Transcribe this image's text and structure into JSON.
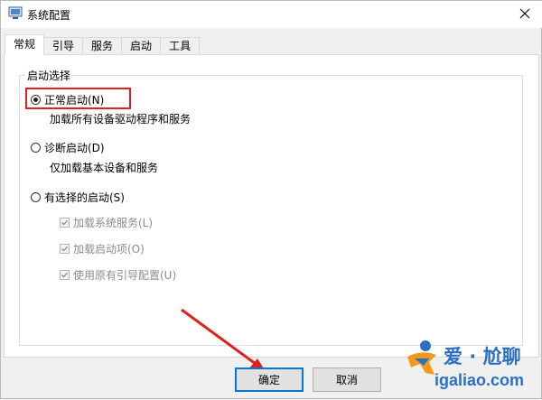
{
  "window": {
    "title": "系统配置",
    "icon": "system-config-icon"
  },
  "tabs": [
    {
      "label": "常规",
      "active": true
    },
    {
      "label": "引导",
      "active": false
    },
    {
      "label": "服务",
      "active": false
    },
    {
      "label": "启动",
      "active": false
    },
    {
      "label": "工具",
      "active": false
    }
  ],
  "startup_selection": {
    "legend": "启动选择",
    "options": [
      {
        "label": "正常启动(N)",
        "description": "加载所有设备驱动程序和服务",
        "selected": true
      },
      {
        "label": "诊断启动(D)",
        "description": "仅加载基本设备和服务",
        "selected": false
      },
      {
        "label": "有选择的启动(S)",
        "description": "",
        "selected": false
      }
    ],
    "selective_items": [
      {
        "label": "加载系统服务(L)",
        "checked": true,
        "enabled": false
      },
      {
        "label": "加载启动项(O)",
        "checked": true,
        "enabled": false
      },
      {
        "label": "使用原有引导配置(U)",
        "checked": true,
        "enabled": false
      }
    ]
  },
  "buttons": {
    "ok": "确定",
    "cancel": "取消"
  },
  "watermark": {
    "brand": "爱 · 尬聊",
    "url": "igaliao.com"
  },
  "colors": {
    "highlight": "#e02020",
    "default_button_border": "#0078d7",
    "watermark": "#2a6fc6"
  }
}
